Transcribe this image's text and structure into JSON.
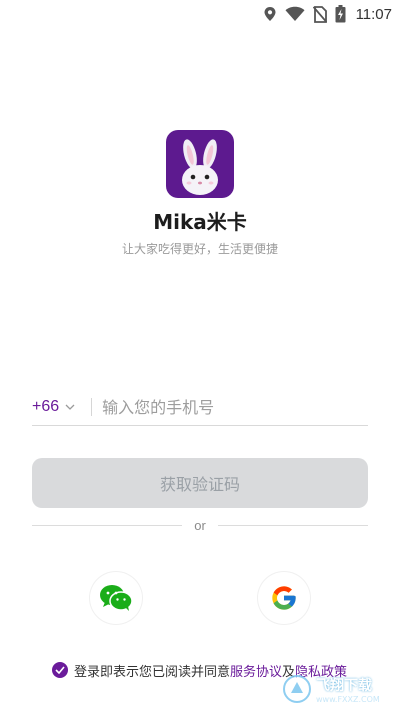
{
  "status_bar": {
    "time": "11:07",
    "icons": [
      "location-icon",
      "wifi-icon",
      "no-sim-icon",
      "battery-icon"
    ]
  },
  "app": {
    "name": "Mika米卡",
    "slogan": "让大家吃得更好，生活更便捷",
    "logo_bg": "#5d1a8f"
  },
  "phone": {
    "country_code": "+66",
    "placeholder": "输入您的手机号"
  },
  "buttons": {
    "get_code": "获取验证码"
  },
  "divider": {
    "or": "or"
  },
  "social": {
    "wechat_icon": "wechat-icon",
    "google_icon": "google-icon"
  },
  "agreement": {
    "prefix": "登录即表示您已阅读并同意",
    "terms": "服务协议",
    "and": "及",
    "privacy": "隐私政策"
  },
  "watermark": {
    "text": "飞翔下载",
    "sub": "www.FXXZ.COM"
  },
  "colors": {
    "accent": "#6a1b9a",
    "button_disabled": "#d9dadc"
  }
}
